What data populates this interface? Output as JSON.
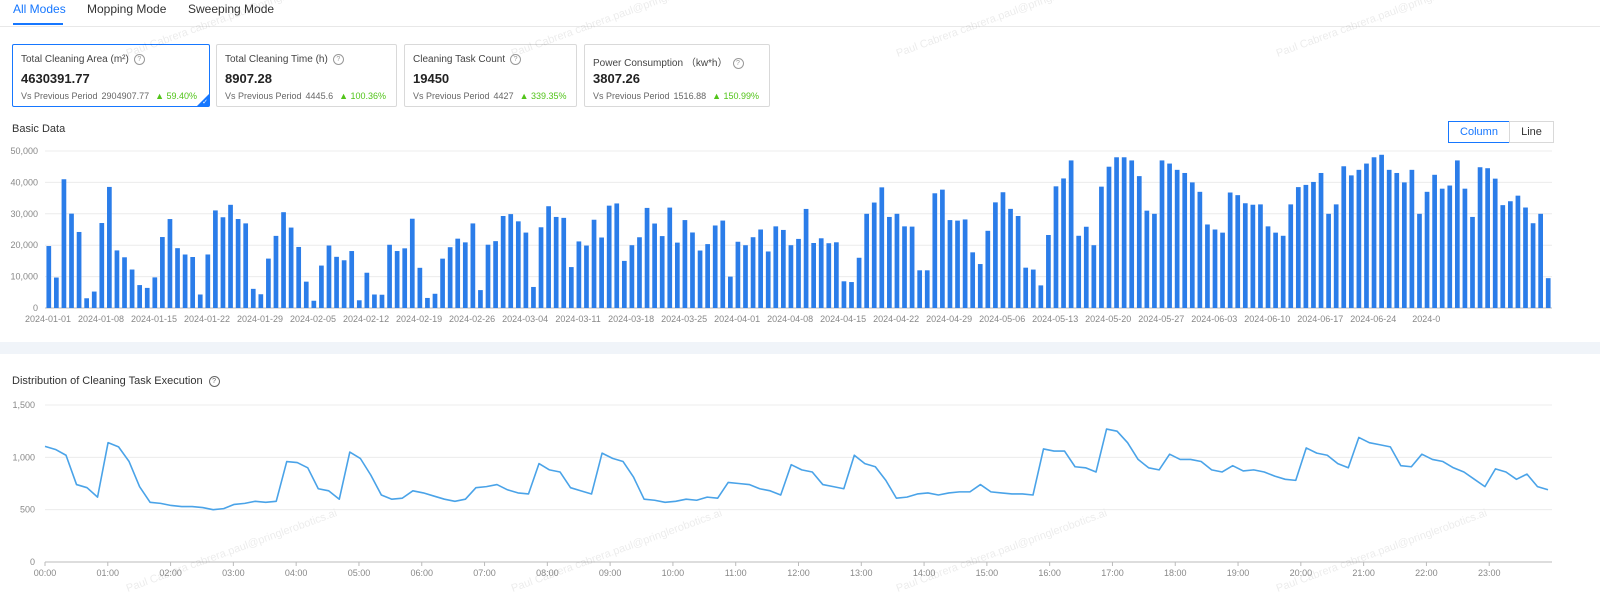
{
  "tabs": [
    "All Modes",
    "Mopping Mode",
    "Sweeping Mode"
  ],
  "cards": [
    {
      "label": "Total Cleaning Area (m²)",
      "value": "4630391.77",
      "cmp_label": "Vs Previous Period",
      "prev": "2904907.77",
      "change": "▲ 59.40%"
    },
    {
      "label": "Total Cleaning Time (h)",
      "value": "8907.28",
      "cmp_label": "Vs Previous Period",
      "prev": "4445.6",
      "change": "▲ 100.36%"
    },
    {
      "label": "Cleaning Task Count",
      "value": "19450",
      "cmp_label": "Vs Previous Period",
      "prev": "4427",
      "change": "▲ 339.35%"
    },
    {
      "label": "Power Consumption （kw*h）",
      "value": "3807.26",
      "cmp_label": "Vs Previous Period",
      "prev": "1516.88",
      "change": "▲ 150.99%"
    }
  ],
  "basic": {
    "title": "Basic Data",
    "toggle": [
      "Column",
      "Line"
    ]
  },
  "distribution": {
    "title": "Distribution of Cleaning Task Execution"
  },
  "watermark": "Paul Cabrera cabrera.paul@pringlerobotics.ai",
  "colors": {
    "accent": "#1677ff",
    "bar": "#2b7de9",
    "line": "#4aa3e8",
    "up": "#52c41a"
  },
  "chart_data": [
    {
      "type": "bar",
      "title": "",
      "xlabel": "",
      "ylabel": "",
      "ylim": [
        0,
        50000
      ],
      "yticks": [
        "0",
        "10,000",
        "20,000",
        "30,000",
        "40,000",
        "50,000"
      ],
      "x_tick_labels": [
        "2024-01-01",
        "2024-01-08",
        "2024-01-15",
        "2024-01-22",
        "2024-01-29",
        "2024-02-05",
        "2024-02-12",
        "2024-02-19",
        "2024-02-26",
        "2024-03-04",
        "2024-03-11",
        "2024-03-18",
        "2024-03-25",
        "2024-04-01",
        "2024-04-08",
        "2024-04-15",
        "2024-04-22",
        "2024-04-29",
        "2024-05-06",
        "2024-05-13",
        "2024-05-20",
        "2024-05-27",
        "2024-06-03",
        "2024-06-10",
        "2024-06-17",
        "2024-06-24",
        "2024-0"
      ],
      "values": [
        19736,
        9700,
        41002,
        30054,
        24214,
        3100,
        5235,
        27064,
        38562,
        18341,
        16150,
        12252,
        7300,
        6400,
        9753,
        22600,
        28325,
        19053,
        17035,
        16240,
        4300,
        17043,
        31077,
        28897,
        32863,
        28337,
        26950,
        6100,
        4380,
        15732,
        22967,
        30508,
        25616,
        19440,
        8394,
        2312,
        13512,
        19899,
        16300,
        15200,
        18140,
        2456,
        11232,
        4300,
        4225,
        20140,
        18140,
        19000,
        28432,
        12800,
        3200,
        4532,
        15717,
        19364,
        22084,
        20900,
        26935,
        5700,
        20160,
        21290,
        29300,
        29900,
        27600,
        24020,
        6700,
        25706,
        32414,
        29000,
        28709,
        13033,
        21200,
        19893,
        28110,
        22450,
        32600,
        33300,
        15000,
        20000,
        22528,
        31877,
        26900,
        22900,
        31977,
        20821,
        28000,
        24052,
        18300,
        20350,
        26276,
        27844,
        10000,
        21100,
        20000,
        22543,
        25000,
        18000,
        26000,
        24860,
        20000,
        22000,
        31552,
        20700,
        22200,
        20627,
        20927,
        8500,
        8264,
        16000,
        30000,
        33583,
        38425,
        29000,
        30000,
        26000,
        25916,
        12000,
        12000,
        36531,
        37693,
        28000,
        27829,
        28200,
        17726,
        14000,
        24583,
        33643,
        36867,
        31571,
        29300,
        12843,
        12242,
        7200,
        23253,
        38746,
        41261,
        47000,
        23000,
        25875,
        20000,
        38645,
        45000,
        48000,
        48000,
        47000,
        42000,
        31000,
        30000,
        47000,
        46000,
        44000,
        43000,
        40000,
        37000,
        26600,
        25000,
        24000,
        36776,
        35941,
        33361,
        32887,
        33000,
        26000,
        24000,
        23000,
        33000,
        38500,
        39200,
        40144,
        43000,
        30000,
        33000,
        45136,
        42237,
        44000,
        46000,
        48000,
        48800,
        44000,
        43000,
        40000,
        44000,
        30000,
        37000,
        42424,
        38000,
        39000,
        47000,
        38000,
        29000,
        44831,
        44520,
        41197,
        32758,
        34000,
        35776,
        32000,
        27000,
        30000,
        9500
      ]
    },
    {
      "type": "line",
      "title": "",
      "xlabel": "",
      "ylabel": "",
      "ylim": [
        0,
        1500
      ],
      "yticks": [
        "0",
        "500",
        "1,000",
        "1,500"
      ],
      "x_tick_labels": [
        "00:00",
        "01:00",
        "02:00",
        "03:00",
        "04:00",
        "05:00",
        "06:00",
        "07:00",
        "08:00",
        "09:00",
        "10:00",
        "11:00",
        "12:00",
        "13:00",
        "14:00",
        "15:00",
        "16:00",
        "17:00",
        "18:00",
        "19:00",
        "20:00",
        "21:00",
        "22:00",
        "23:00"
      ],
      "values": [
        1105,
        1075,
        1020,
        740,
        710,
        620,
        1140,
        1100,
        960,
        720,
        570,
        560,
        540,
        530,
        530,
        520,
        500,
        510,
        550,
        560,
        580,
        570,
        580,
        960,
        950,
        900,
        700,
        680,
        600,
        1050,
        990,
        830,
        640,
        600,
        610,
        680,
        660,
        630,
        600,
        580,
        600,
        710,
        720,
        740,
        690,
        660,
        650,
        940,
        880,
        860,
        710,
        680,
        650,
        1040,
        990,
        960,
        810,
        600,
        590,
        570,
        580,
        600,
        590,
        620,
        610,
        760,
        750,
        740,
        700,
        680,
        640,
        930,
        880,
        860,
        740,
        720,
        700,
        1020,
        940,
        910,
        780,
        610,
        620,
        650,
        660,
        640,
        660,
        670,
        670,
        740,
        670,
        660,
        650,
        650,
        640,
        1080,
        1060,
        1060,
        910,
        900,
        860,
        1270,
        1250,
        1140,
        980,
        900,
        880,
        1030,
        980,
        980,
        960,
        880,
        860,
        920,
        870,
        880,
        860,
        820,
        790,
        780,
        1090,
        1040,
        1020,
        940,
        900,
        1190,
        1140,
        1120,
        1100,
        920,
        910,
        1030,
        980,
        960,
        900,
        860,
        790,
        720,
        890,
        860,
        790,
        840,
        720,
        690
      ]
    }
  ]
}
